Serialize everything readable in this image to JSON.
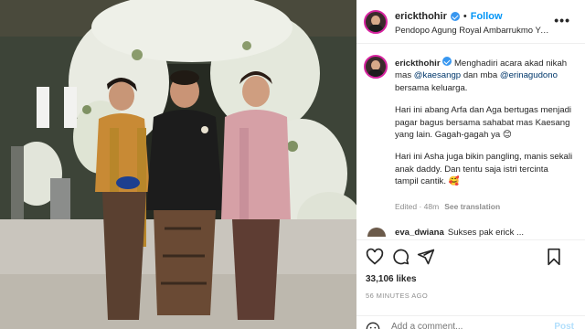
{
  "header": {
    "username": "erickthohir",
    "separator": "•",
    "follow_label": "Follow",
    "location": "Pendopo Agung Royal Ambarrukmo Yo...",
    "more_label": "•••"
  },
  "caption": {
    "username": "erickthohir",
    "p1_text1": "Menghadiri acara akad nikah mas ",
    "p1_mention1": "@kaesangp",
    "p1_text2": " dan mba ",
    "p1_mention2": "@erinagudono",
    "p1_text3": " bersama keluarga.",
    "p2": "Hari ini abang Arfa dan Aga bertugas menjadi pagar bagus bersama sahabat mas Kaesang yang lain. Gagah-gagah ya 😊",
    "p3": "Hari ini Asha juga bikin pangling, manis sekali anak daddy. Dan tentu saja istri tercinta tampil cantik. 🥰"
  },
  "meta": {
    "edited": "Edited",
    "age": "48m",
    "see_translation": "See translation"
  },
  "comment": {
    "username": "eva_dwiana",
    "text": "Sukses pak erick ..."
  },
  "actions": {
    "likes": "33,106 likes",
    "time": "56 MINUTES AGO",
    "add_comment_placeholder": "Add a comment...",
    "post_label": "Post"
  },
  "icons": [
    "heart-icon",
    "comment-icon",
    "share-icon",
    "bookmark-icon",
    "emoji-icon",
    "verified-badge-icon"
  ],
  "colors": {
    "accent": "#0095f6",
    "verified": "#3897f0",
    "muted": "#8e8e8e",
    "post_disabled": "#b2dffc"
  }
}
